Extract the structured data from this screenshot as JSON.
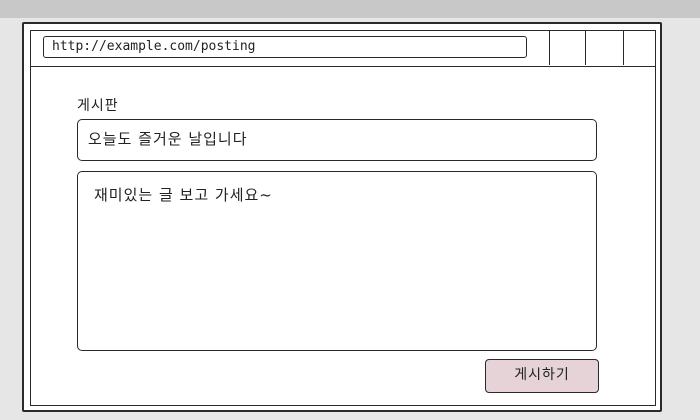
{
  "browser": {
    "url": "http://example.com/posting"
  },
  "board": {
    "label": "게시판",
    "title_value": "오늘도 즐거운 날입니다",
    "content_value": "재미있는 글 보고 가세요~",
    "submit_label": "게시하기"
  },
  "colors": {
    "submit_bg": "#e6d3d8",
    "frame_gray": "#d9d9d9"
  }
}
